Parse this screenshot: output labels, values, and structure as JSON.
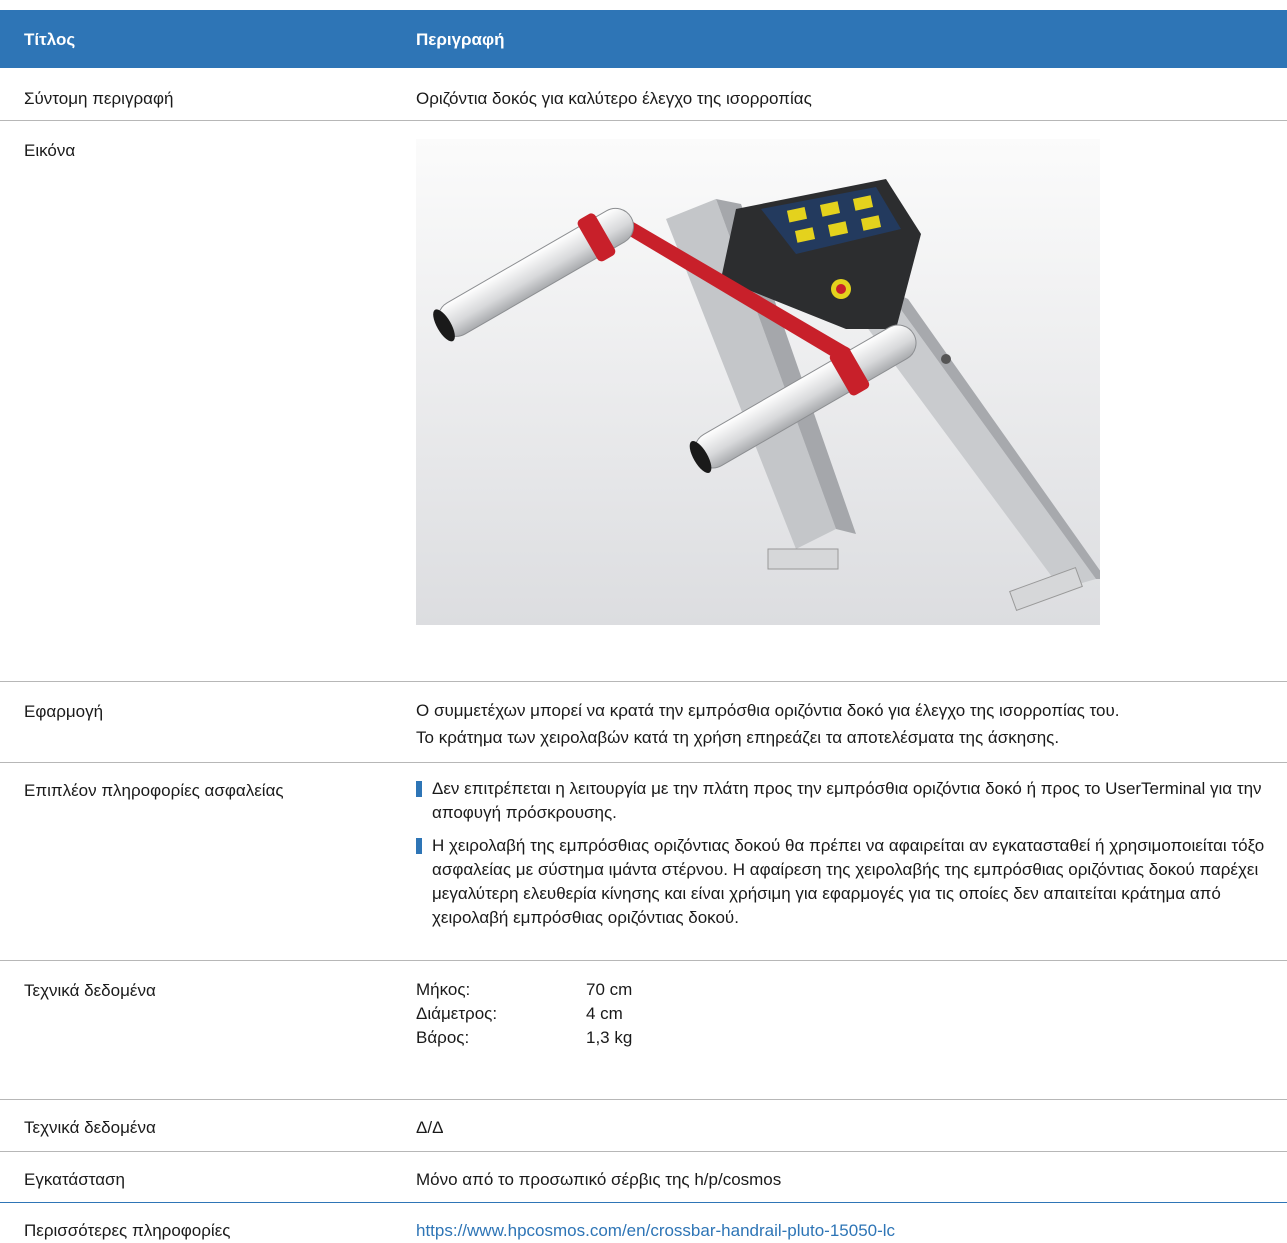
{
  "header": {
    "col1": "Τίτλος",
    "col2": "Περιγραφή"
  },
  "rows": {
    "short": {
      "label": "Σύντομη περιγραφή",
      "value": "Οριζόντια δοκός για καλύτερο έλεγχο της ισορροπίας"
    },
    "image": {
      "label": "Εικόνα"
    },
    "application": {
      "label": "Εφαρμογή",
      "line1": "Ο συμμετέχων μπορεί να κρατά την εμπρόσθια οριζόντια δοκό για έλεγχο της ισορροπίας του.",
      "line2": "Το κράτημα των χειρολαβών κατά τη χρήση επηρεάζει τα αποτελέσματα της άσκησης."
    },
    "safety": {
      "label": "Επιπλέον πληροφορίες ασφαλείας",
      "bullets": [
        "Δεν επιτρέπεται η λειτουργία με την πλάτη προς την εμπρόσθια οριζόντια δοκό ή προς το UserTerminal για την αποφυγή πρόσκρουσης.",
        "Η χειρολαβή της εμπρόσθιας οριζόντιας δοκού θα πρέπει να αφαιρείται αν εγκατασταθεί ή χρησιμοποιείται τόξο ασφαλείας με σύστημα ιμάντα στέρνου. Η αφαίρεση της χειρολαβής της εμπρόσθιας οριζόντιας δοκού παρέχει μεγαλύτερη ελευθερία κίνησης και είναι χρήσιμη για εφαρμογές για τις οποίες δεν απαιτείται κράτημα από χειρολαβή εμπρόσθιας οριζόντιας δοκού."
      ]
    },
    "tech": {
      "label": "Τεχνικά δεδομένα",
      "specs": [
        {
          "k": "Μήκος:",
          "v": "70 cm"
        },
        {
          "k": "Διάμετρος:",
          "v": "4 cm"
        },
        {
          "k": "Βάρος:",
          "v": "1,3 kg"
        }
      ]
    },
    "tech2": {
      "label": "Τεχνικά δεδομένα",
      "value": "Δ/Δ"
    },
    "install": {
      "label": "Εγκατάσταση",
      "value": "Μόνο από το προσωπικό σέρβις της h/p/cosmos"
    },
    "more": {
      "label": "Περισσότερες πληροφορίες",
      "value": "https://www.hpcosmos.com/en/crossbar-handrail-pluto-15050-lc"
    }
  },
  "colors": {
    "header": "#2e75b6",
    "bar": "#c8202a"
  }
}
